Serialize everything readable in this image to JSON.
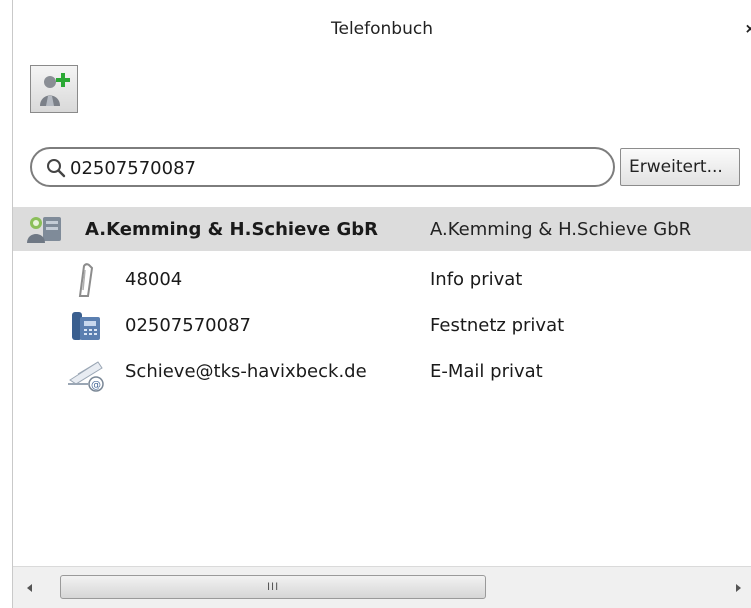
{
  "window": {
    "title": "Telefonbuch",
    "close_label": "×"
  },
  "toolbar": {
    "add_contact_icon": "add-contact-icon"
  },
  "search": {
    "value": "02507570087",
    "icon": "search-icon"
  },
  "advanced_button": {
    "label": "Erweitert..."
  },
  "contact": {
    "name": "A.Kemming & H.Schieve GbR",
    "display_name": "A.Kemming & H.Schieve GbR",
    "icon": "contact-card-icon",
    "entries": [
      {
        "icon": "note-clip-icon",
        "value": "48004",
        "type": "Info privat"
      },
      {
        "icon": "landline-phone-icon",
        "value": "02507570087",
        "type": "Festnetz privat"
      },
      {
        "icon": "email-icon",
        "value": "Schieve@tks-havixbeck.de",
        "type": "E-Mail privat"
      }
    ]
  },
  "scrollbar": {
    "grip": "III"
  },
  "colors": {
    "header_row_bg": "#dcdcdc",
    "add_icon_green": "#2aa834",
    "scroll_bg": "#f0f0f0"
  }
}
